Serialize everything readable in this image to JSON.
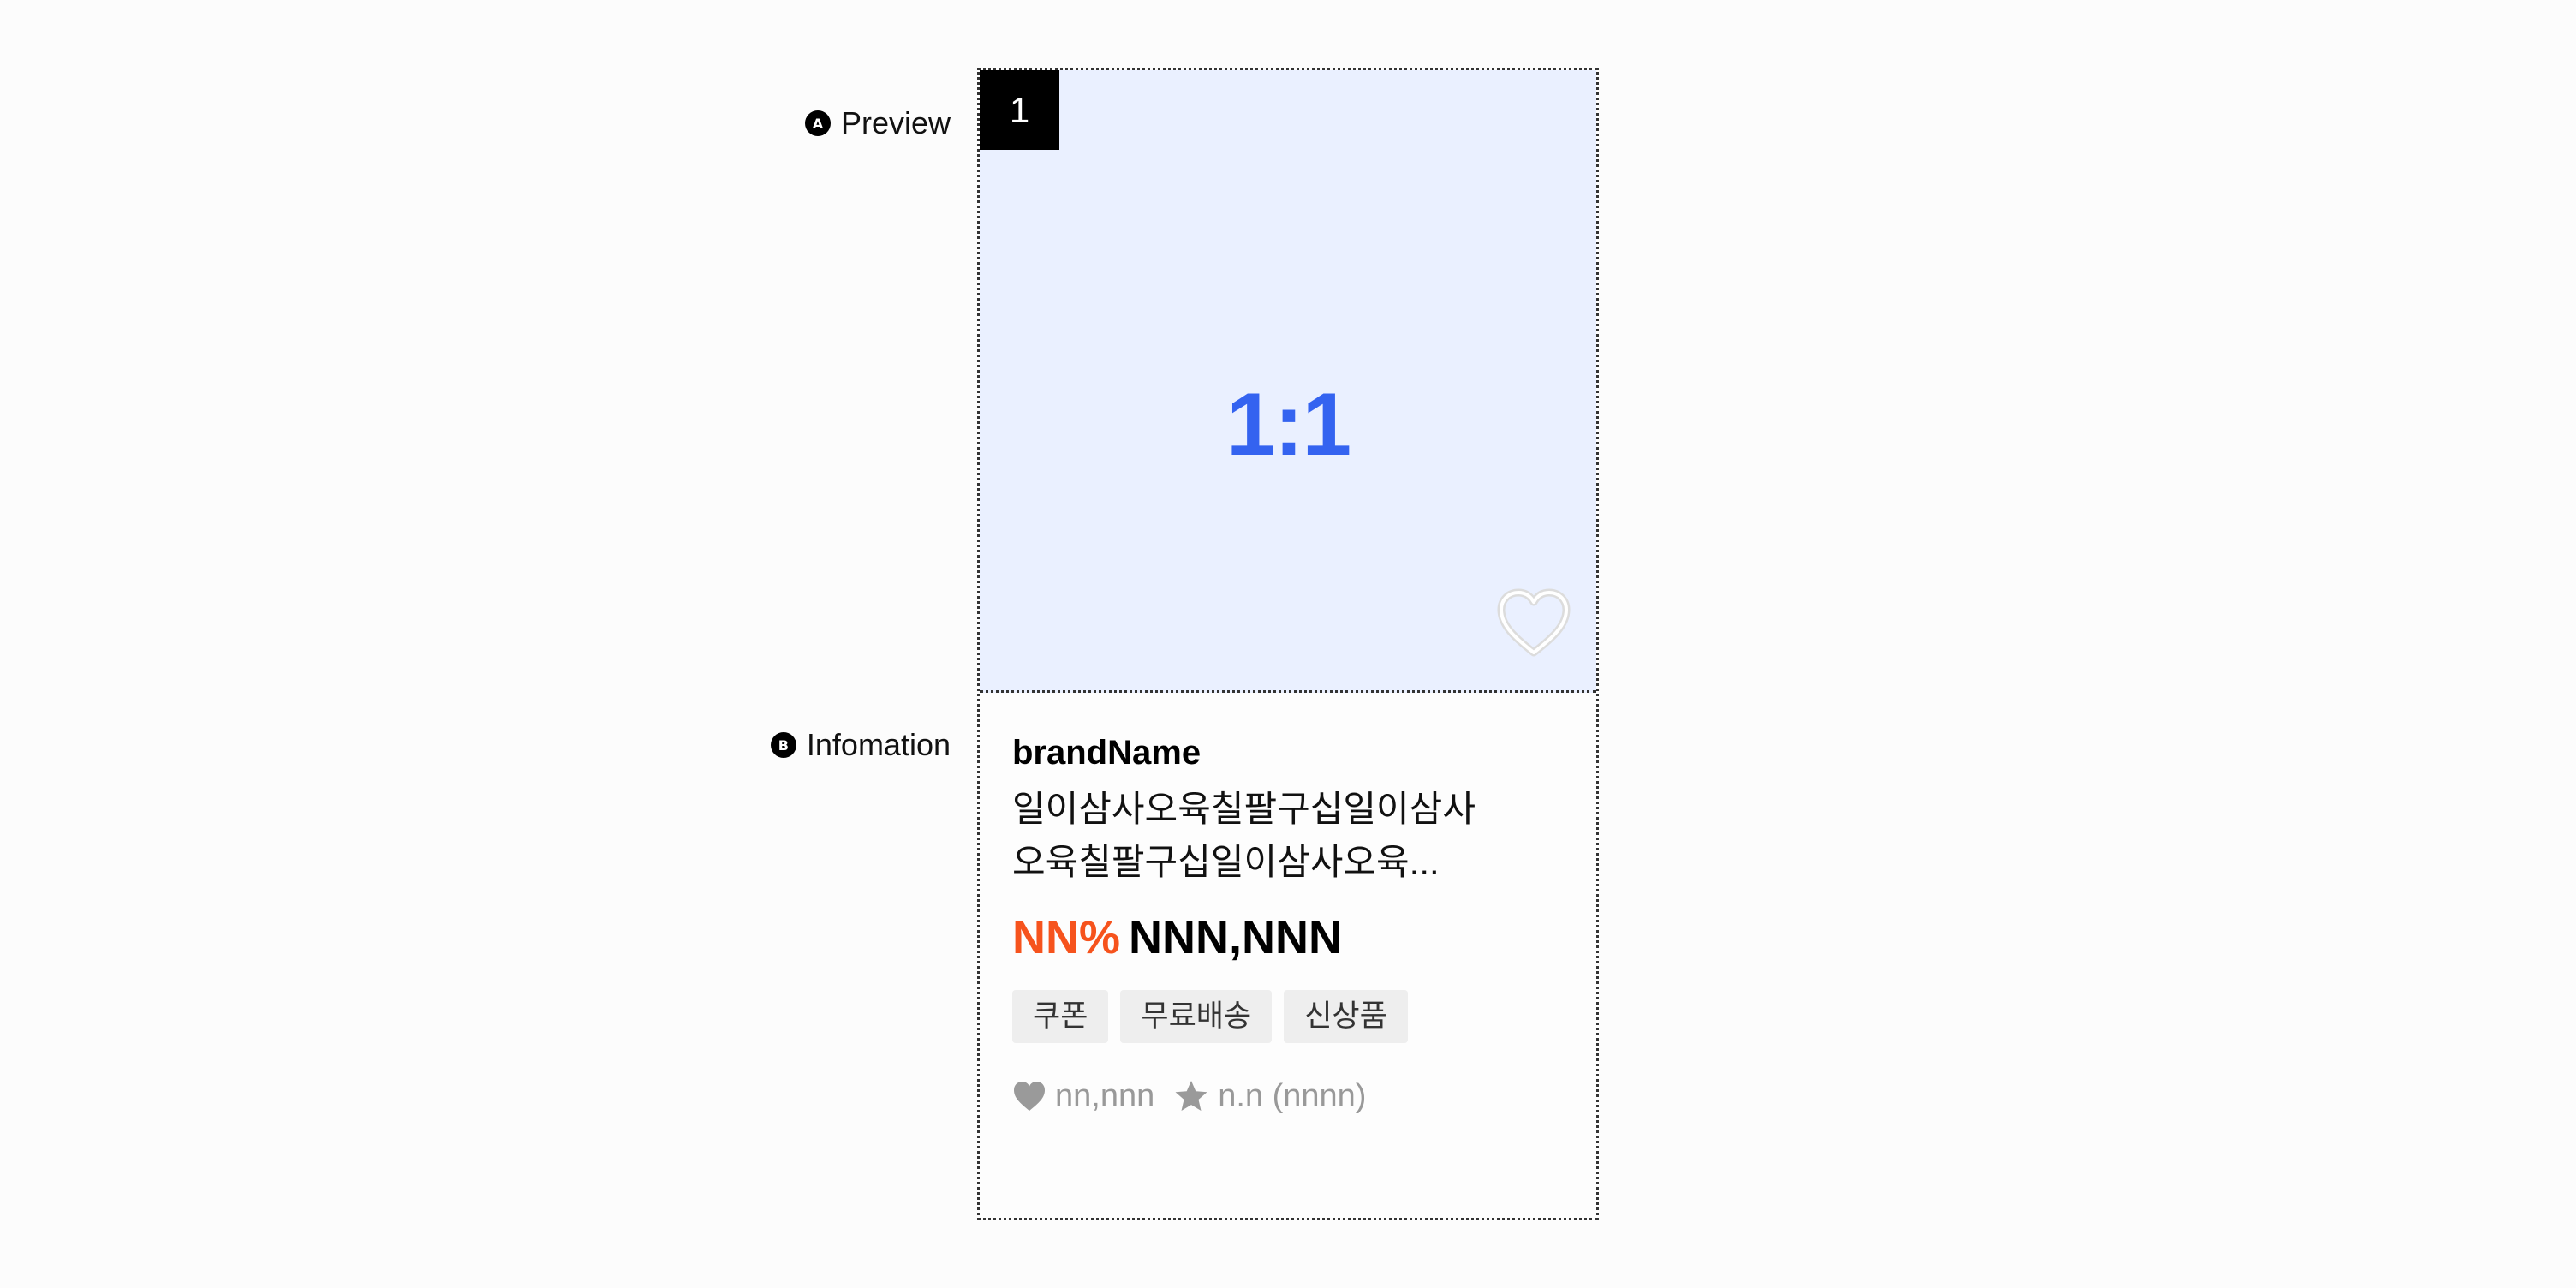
{
  "annotations": {
    "preview": {
      "badge": "A",
      "label": "Preview"
    },
    "information": {
      "badge": "B",
      "label": "Infomation"
    }
  },
  "card": {
    "rank": "1",
    "image_ratio": "1:1",
    "preview_bg": "#eaf0ff",
    "ratio_color": "#3463f0",
    "wishlist_icon": "heart-outline-icon",
    "brand": "brandName",
    "title_line1": "일이삼사오육칠팔구십일이삼사",
    "title_line2": "오육칠팔구십일이삼사오육...",
    "discount": "NN%",
    "discount_color": "#f6531d",
    "price": "NNN,NNN",
    "tags": [
      "쿠폰",
      "무료배송",
      "신상품"
    ],
    "likes": "nn,nnn",
    "likes_icon": "heart-icon",
    "rating": "n.n (nnnn)",
    "rating_icon": "star-icon"
  }
}
